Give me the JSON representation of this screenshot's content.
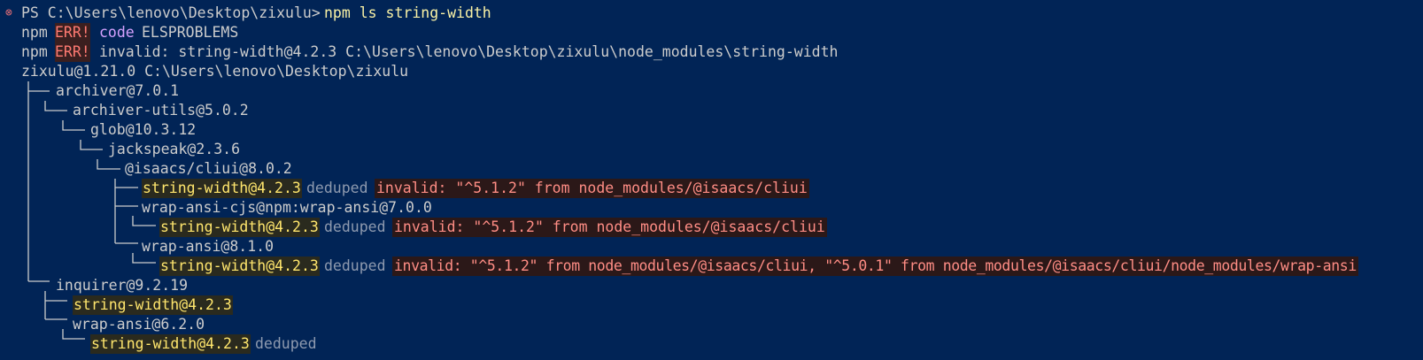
{
  "prompt": {
    "prefix": "PS C:\\Users\\lenovo\\Desktop\\zixulu>",
    "command": "npm ls string-width",
    "status_icon": "error-circle-icon",
    "status_glyph": "⊗"
  },
  "errors": [
    {
      "npm": "npm",
      "err": "ERR!",
      "kw": "code",
      "text": "ELSPROBLEMS"
    },
    {
      "npm": "npm",
      "err": "ERR!",
      "kw": "",
      "text": "invalid: string-width@4.2.3 C:\\Users\\lenovo\\Desktop\\zixulu\\node_modules\\string-width"
    }
  ],
  "root": "zixulu@1.21.0 C:\\Users\\lenovo\\Desktop\\zixulu",
  "tree": [
    {
      "name": "archiver@7.0.1"
    },
    {
      "name": "archiver-utils@5.0.2"
    },
    {
      "name": "glob@10.3.12"
    },
    {
      "name": "jackspeak@2.3.6"
    },
    {
      "name": "@isaacs/cliui@8.0.2"
    },
    {
      "name": "string-width@4.2.3",
      "deduped": "deduped",
      "invalid": "invalid: \"^5.1.2\" from node_modules/@isaacs/cliui"
    },
    {
      "name": "wrap-ansi-cjs@npm:wrap-ansi@7.0.0"
    },
    {
      "name": "string-width@4.2.3",
      "deduped": "deduped",
      "invalid": "invalid: \"^5.1.2\" from node_modules/@isaacs/cliui"
    },
    {
      "name": "wrap-ansi@8.1.0"
    },
    {
      "name": "string-width@4.2.3",
      "deduped": "deduped",
      "invalid": "invalid: \"^5.1.2\" from node_modules/@isaacs/cliui, \"^5.0.1\" from node_modules/@isaacs/cliui/node_modules/wrap-ansi"
    },
    {
      "name": "inquirer@9.2.19"
    },
    {
      "name": "string-width@4.2.3"
    },
    {
      "name": "wrap-ansi@6.2.0"
    },
    {
      "name": "string-width@4.2.3",
      "deduped": "deduped"
    }
  ],
  "colors": {
    "background": "#012456",
    "foreground": "#cccccc",
    "command": "#f9f1a5",
    "error": "#ff7a72",
    "keyword": "#d6a2ff",
    "highlight": "#ffe66d",
    "invalid": "#ff8d85"
  }
}
